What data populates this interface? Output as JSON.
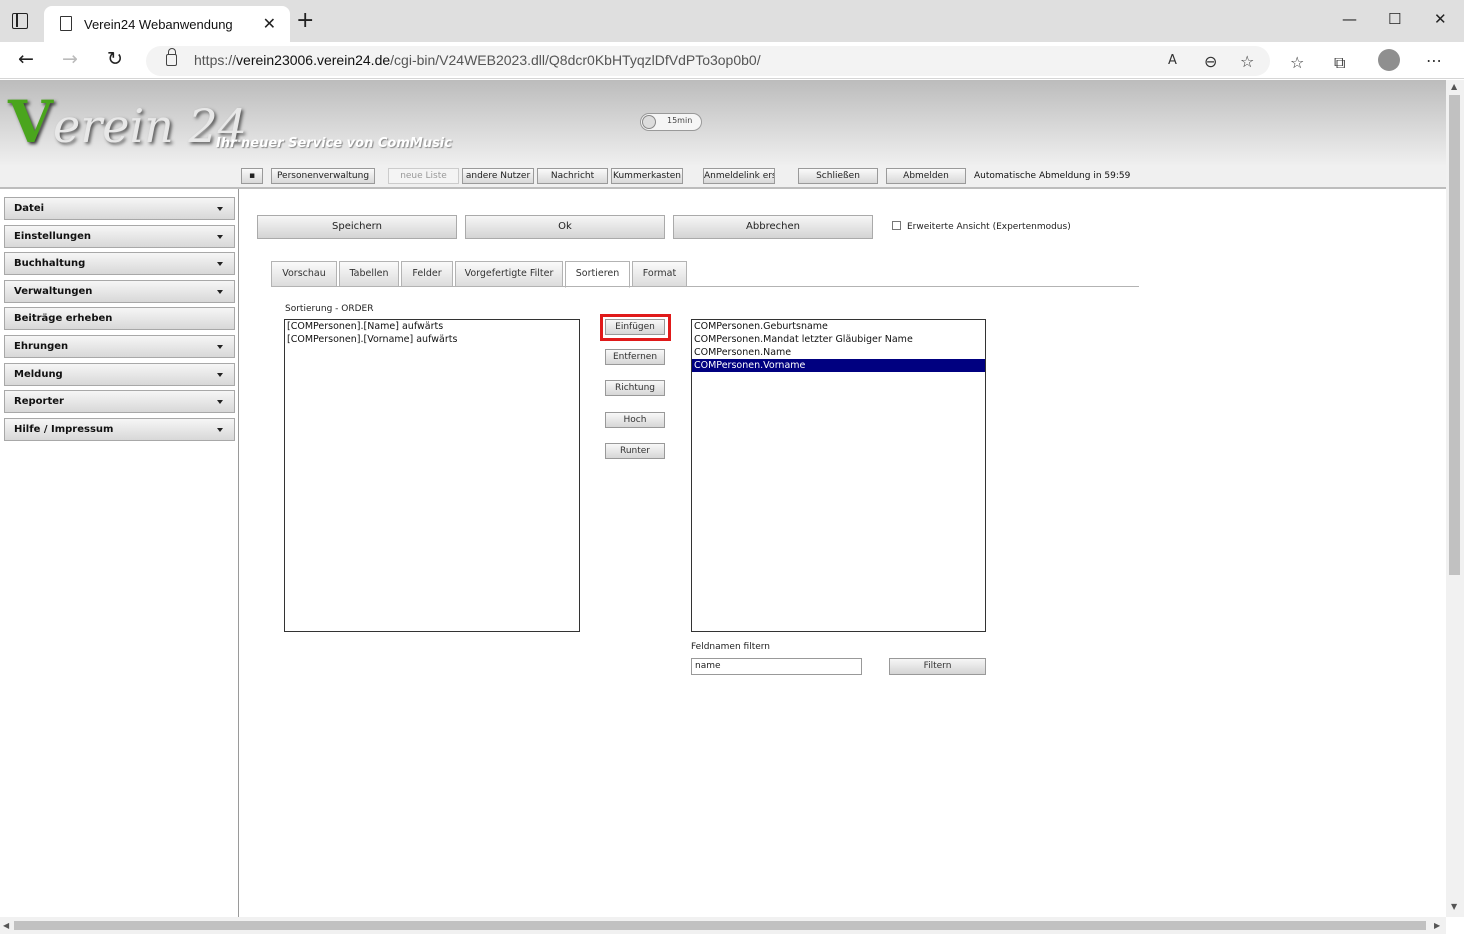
{
  "browser": {
    "tab_title": "Verein24 Webanwendung",
    "url_prefix": "https://",
    "url_host": "verein23006.verein24.de",
    "url_path": "/cgi-bin/V24WEB2023.dll/Q8dcr0KbHTyqzlDfVdPTo3op0b0/"
  },
  "header": {
    "logo": "Verein 24",
    "tagline": "Ihr neuer Service von ComMusic",
    "toggle_label": "15min"
  },
  "toolbar": {
    "buttons": [
      {
        "label": "Personenverwaltung"
      },
      {
        "label": "neue Liste"
      },
      {
        "label": "andere Nutzer"
      },
      {
        "label": "Nachricht"
      },
      {
        "label": "Kummerkasten"
      },
      {
        "label": "Anmeldelink erst"
      },
      {
        "label": "Schließen"
      },
      {
        "label": "Abmelden"
      }
    ],
    "auto_logout": "Automatische Abmeldung in 59:59"
  },
  "sidebar": {
    "items": [
      {
        "label": "Datei"
      },
      {
        "label": "Einstellungen"
      },
      {
        "label": "Buchhaltung"
      },
      {
        "label": "Verwaltungen"
      },
      {
        "label": "Beiträge erheben"
      },
      {
        "label": "Ehrungen"
      },
      {
        "label": "Meldung"
      },
      {
        "label": "Reporter"
      },
      {
        "label": "Hilfe / Impressum"
      }
    ]
  },
  "main": {
    "save_label": "Speichern",
    "ok_label": "Ok",
    "cancel_label": "Abbrechen",
    "expert_label": "Erweiterte Ansicht (Expertenmodus)",
    "tabs": [
      {
        "label": "Vorschau"
      },
      {
        "label": "Tabellen"
      },
      {
        "label": "Felder"
      },
      {
        "label": "Vorgefertigte Filter"
      },
      {
        "label": "Sortieren"
      },
      {
        "label": "Format"
      }
    ],
    "active_tab": "Sortieren",
    "order_label": "Sortierung - ORDER",
    "order_items": [
      "[COMPersonen].[Name] aufwärts",
      "[COMPersonen].[Vorname] aufwärts"
    ],
    "actions": {
      "insert": "Einfügen",
      "remove": "Entfernen",
      "direction": "Richtung",
      "up": "Hoch",
      "down": "Runter"
    },
    "fields": [
      "COMPersonen.Geburtsname",
      "COMPersonen.Mandat letzter Gläubiger Name",
      "COMPersonen.Name",
      "COMPersonen.Vorname"
    ],
    "selected_field": "COMPersonen.Vorname",
    "filter_label": "Feldnamen filtern",
    "filter_value": "name",
    "filter_button": "Filtern"
  }
}
